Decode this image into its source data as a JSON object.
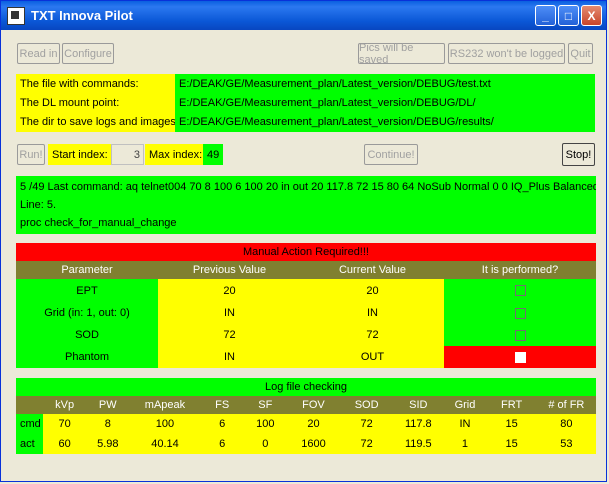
{
  "window": {
    "title": "TXT Innova Pilot",
    "minimize": "_",
    "maximize": "□",
    "close": "X"
  },
  "toolbar": {
    "read_in": "Read in",
    "configure": "Configure",
    "pics_saved": "Pics will be saved",
    "rs232": "RS232 won't be logged",
    "quit": "Quit"
  },
  "paths": [
    {
      "label": "The file with commands:",
      "value": "E:/DEAK/GE/Measurement_plan/Latest_version/DEBUG/test.txt"
    },
    {
      "label": "The DL mount point:",
      "value": "E:/DEAK/GE/Measurement_plan/Latest_version/DEBUG/DL/"
    },
    {
      "label": "The dir to save logs and images:",
      "value": "E:/DEAK/GE/Measurement_plan/Latest_version/DEBUG/results/"
    }
  ],
  "run": {
    "run_label": "Run!",
    "start_label": "Start index:",
    "start_value": "3",
    "max_label": "Max index:",
    "max_value": "49",
    "continue_label": "Continue!",
    "stop_label": "Stop!"
  },
  "status": {
    "line1": "5 /49 Last command: aq telnet004 70 8 100 6 100 20 in out 20 117.8 72 15 80 64 NoSub Normal 0 0 IQ_Plus Balanced_IQ",
    "line2": "Line: 5.",
    "line3": "proc check_for_manual_change"
  },
  "manual": {
    "banner": "Manual Action Required!!!",
    "headers": [
      "Parameter",
      "Previous Value",
      "Current Value",
      "It is performed?"
    ],
    "rows": [
      {
        "param": "EPT",
        "prev": "20",
        "curr": "20",
        "performed": "checked-dim"
      },
      {
        "param": "Grid (in: 1, out: 0)",
        "prev": "IN",
        "curr": "IN",
        "performed": "checked-dim"
      },
      {
        "param": "SOD",
        "prev": "72",
        "curr": "72",
        "performed": "checked-dim"
      },
      {
        "param": "Phantom",
        "prev": "IN",
        "curr": "OUT",
        "performed": "unchecked"
      }
    ]
  },
  "log": {
    "banner": "Log file checking",
    "headers": [
      "",
      "kVp",
      "PW",
      "mApeak",
      "FS",
      "SF",
      "FOV",
      "SOD",
      "SID",
      "Grid",
      "FRT",
      "# of FR"
    ],
    "rows": [
      [
        "cmd",
        "70",
        "8",
        "100",
        "6",
        "100",
        "20",
        "72",
        "117.8",
        "IN",
        "15",
        "80"
      ],
      [
        "act",
        "60",
        "5.98",
        "40.14",
        "6",
        "0",
        "1600",
        "72",
        "119.5",
        "1",
        "15",
        "53"
      ]
    ]
  },
  "colors": {
    "ok": "#00ff00",
    "warn": "#ffff00",
    "alert": "#ff0000",
    "header": "#808030"
  }
}
